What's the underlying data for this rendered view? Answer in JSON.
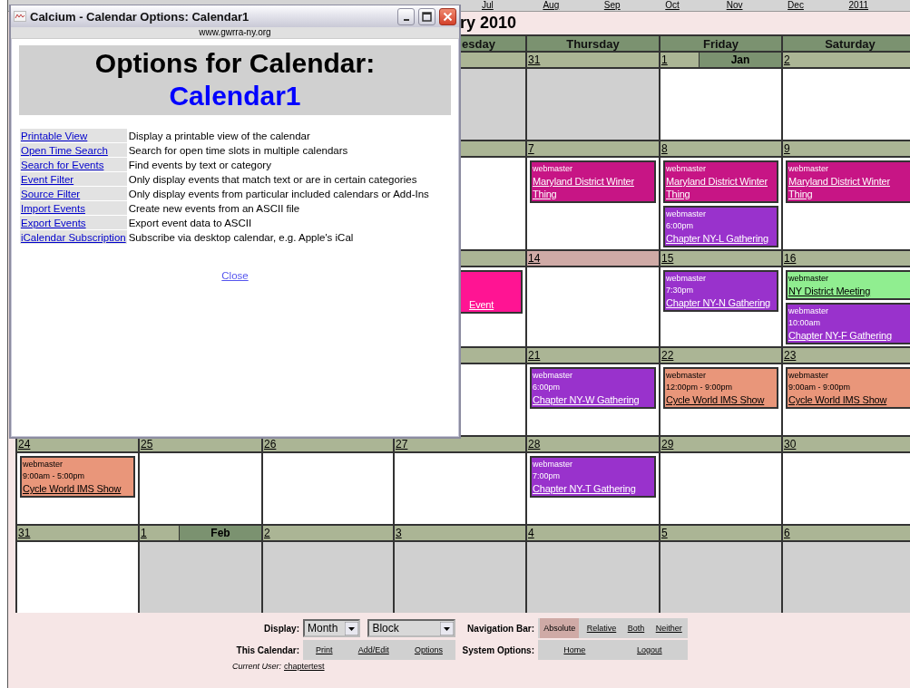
{
  "month_links": [
    "Jul",
    "Aug",
    "Sep",
    "Oct",
    "Nov",
    "Dec",
    "2011"
  ],
  "calendar_title": "ry 2010",
  "day_headers": [
    {
      "label": "esday"
    },
    {
      "label": "Thursday"
    },
    {
      "label": "Friday"
    },
    {
      "label": "Saturday"
    }
  ],
  "weeks": [
    {
      "days": [
        {
          "outside_month": true,
          "today": false
        },
        {
          "date": "31",
          "outside_month": true,
          "today": false
        },
        {
          "date": "1",
          "month_label": "Jan",
          "outside_month": false,
          "today": false
        },
        {
          "date": "2",
          "outside_month": false,
          "today": false
        }
      ]
    },
    {
      "days": [
        {
          "outside_month": false,
          "today": false
        },
        {
          "date": "7",
          "outside_month": false,
          "today": false,
          "events": [
            {
              "author": "webmaster",
              "title": "Maryland District Winter Thing",
              "color": "#c71585"
            }
          ]
        },
        {
          "date": "8",
          "outside_month": false,
          "today": false,
          "events": [
            {
              "author": "webmaster",
              "title": "Maryland District Winter Thing",
              "color": "#c71585"
            },
            {
              "author": "webmaster",
              "time": "6:00pm",
              "title": "Chapter NY-L Gathering",
              "color": "#9932cc"
            }
          ]
        },
        {
          "date": "9",
          "outside_month": false,
          "today": false,
          "events": [
            {
              "author": "webmaster",
              "title": "Maryland District Winter Thing",
              "color": "#c71585"
            }
          ]
        }
      ]
    },
    {
      "days": [
        {
          "outside_month": false,
          "today": false,
          "events": [
            {
              "title": "Event",
              "color": "#ff1493"
            }
          ]
        },
        {
          "date": "14",
          "outside_month": false,
          "today": true
        },
        {
          "date": "15",
          "outside_month": false,
          "today": false,
          "events": [
            {
              "author": "webmaster",
              "time": "7:30pm",
              "title": "Chapter NY-N Gathering",
              "color": "#9932cc"
            }
          ]
        },
        {
          "date": "16",
          "outside_month": false,
          "today": false,
          "events": [
            {
              "author": "webmaster",
              "title": "NY District Meeting",
              "color": "#90ee90"
            },
            {
              "author": "webmaster",
              "time": "10:00am",
              "title": "Chapter NY-F Gathering",
              "color": "#9932cc"
            }
          ]
        }
      ]
    },
    {
      "days": [
        {
          "outside_month": false,
          "today": false
        },
        {
          "date": "21",
          "outside_month": false,
          "today": false,
          "events": [
            {
              "author": "webmaster",
              "time": "6:00pm",
              "title": "Chapter NY-W Gathering",
              "color": "#9932cc"
            }
          ]
        },
        {
          "date": "22",
          "outside_month": false,
          "today": false,
          "events": [
            {
              "author": "webmaster",
              "time": "12:00pm - 9:00pm",
              "title": "Cycle World IMS Show",
              "color": "#e9967a"
            }
          ]
        },
        {
          "date": "23",
          "outside_month": false,
          "today": false,
          "events": [
            {
              "author": "webmaster",
              "time": "9:00am - 9:00pm",
              "title": "Cycle World IMS Show",
              "color": "#e9967a"
            }
          ]
        }
      ]
    },
    {
      "days": [
        {
          "date": "24",
          "outside_month": false,
          "today": false,
          "events": [
            {
              "author": "webmaster",
              "time": "9:00am - 5:00pm",
              "title": "Cycle World IMS Show",
              "color": "#e9967a"
            }
          ]
        },
        {
          "date": "25",
          "outside_month": false,
          "today": false
        },
        {
          "date": "26",
          "outside_month": false,
          "today": false
        },
        {
          "date": "27",
          "outside_month": false,
          "today": false
        },
        {
          "date": "28",
          "outside_month": false,
          "today": false,
          "events": [
            {
              "author": "webmaster",
              "time": "7:00pm",
              "title": "Chapter NY-T Gathering",
              "color": "#9932cc"
            }
          ]
        },
        {
          "date": "29",
          "outside_month": false,
          "today": false
        },
        {
          "date": "30",
          "outside_month": false,
          "today": false
        }
      ]
    },
    {
      "days": [
        {
          "date": "31",
          "outside_month": false,
          "today": false
        },
        {
          "date": "1",
          "month_label": "Feb",
          "outside_month": true,
          "today": false
        },
        {
          "date": "2",
          "outside_month": true,
          "today": false
        },
        {
          "date": "3",
          "outside_month": true,
          "today": false
        },
        {
          "date": "4",
          "outside_month": true,
          "today": false
        },
        {
          "date": "5",
          "outside_month": true,
          "today": false
        },
        {
          "date": "6",
          "outside_month": true,
          "today": false
        }
      ]
    }
  ],
  "footer": {
    "display_label": "Display:",
    "view_select": "Month",
    "style_select": "Block",
    "navigation_label": "Navigation Bar:",
    "navigation_options": [
      {
        "label": "Absolute",
        "selected": true
      },
      {
        "label": "Relative",
        "selected": false
      },
      {
        "label": "Both",
        "selected": false
      },
      {
        "label": "Neither",
        "selected": false
      }
    ],
    "calendar_label": "This Calendar:",
    "calendar_links": [
      "Print",
      "Add/Edit",
      "Options"
    ],
    "system_label": "System Options:",
    "system_links": [
      "Home",
      "Logout"
    ],
    "current_user_label": "Current User:",
    "current_user": "chaptertest"
  },
  "popup": {
    "title": "Calcium - Calendar Options: Calendar1",
    "address": "www.gwrra-ny.org",
    "heading": "Options for Calendar:",
    "calendar_name": "Calendar1",
    "options": [
      {
        "link": "Printable View",
        "description": "Display a printable view of the calendar"
      },
      {
        "link": "Open Time Search",
        "description": "Search for open time slots in multiple calendars"
      },
      {
        "link": "Search for Events",
        "description": "Find events by text or category"
      },
      {
        "link": "Event Filter",
        "description": "Only display events that match text or are in certain categories"
      },
      {
        "link": "Source Filter",
        "description": "Only display events from particular included calendars or Add-Ins"
      },
      {
        "link": "Import Events",
        "description": "Create new events from an ASCII file"
      },
      {
        "link": "Export Events",
        "description": "Export event data to ASCII"
      },
      {
        "link": "iCalendar Subscription",
        "description": "Subscribe via desktop calendar, e.g. Apple's iCal"
      }
    ],
    "close_link": "Close"
  }
}
